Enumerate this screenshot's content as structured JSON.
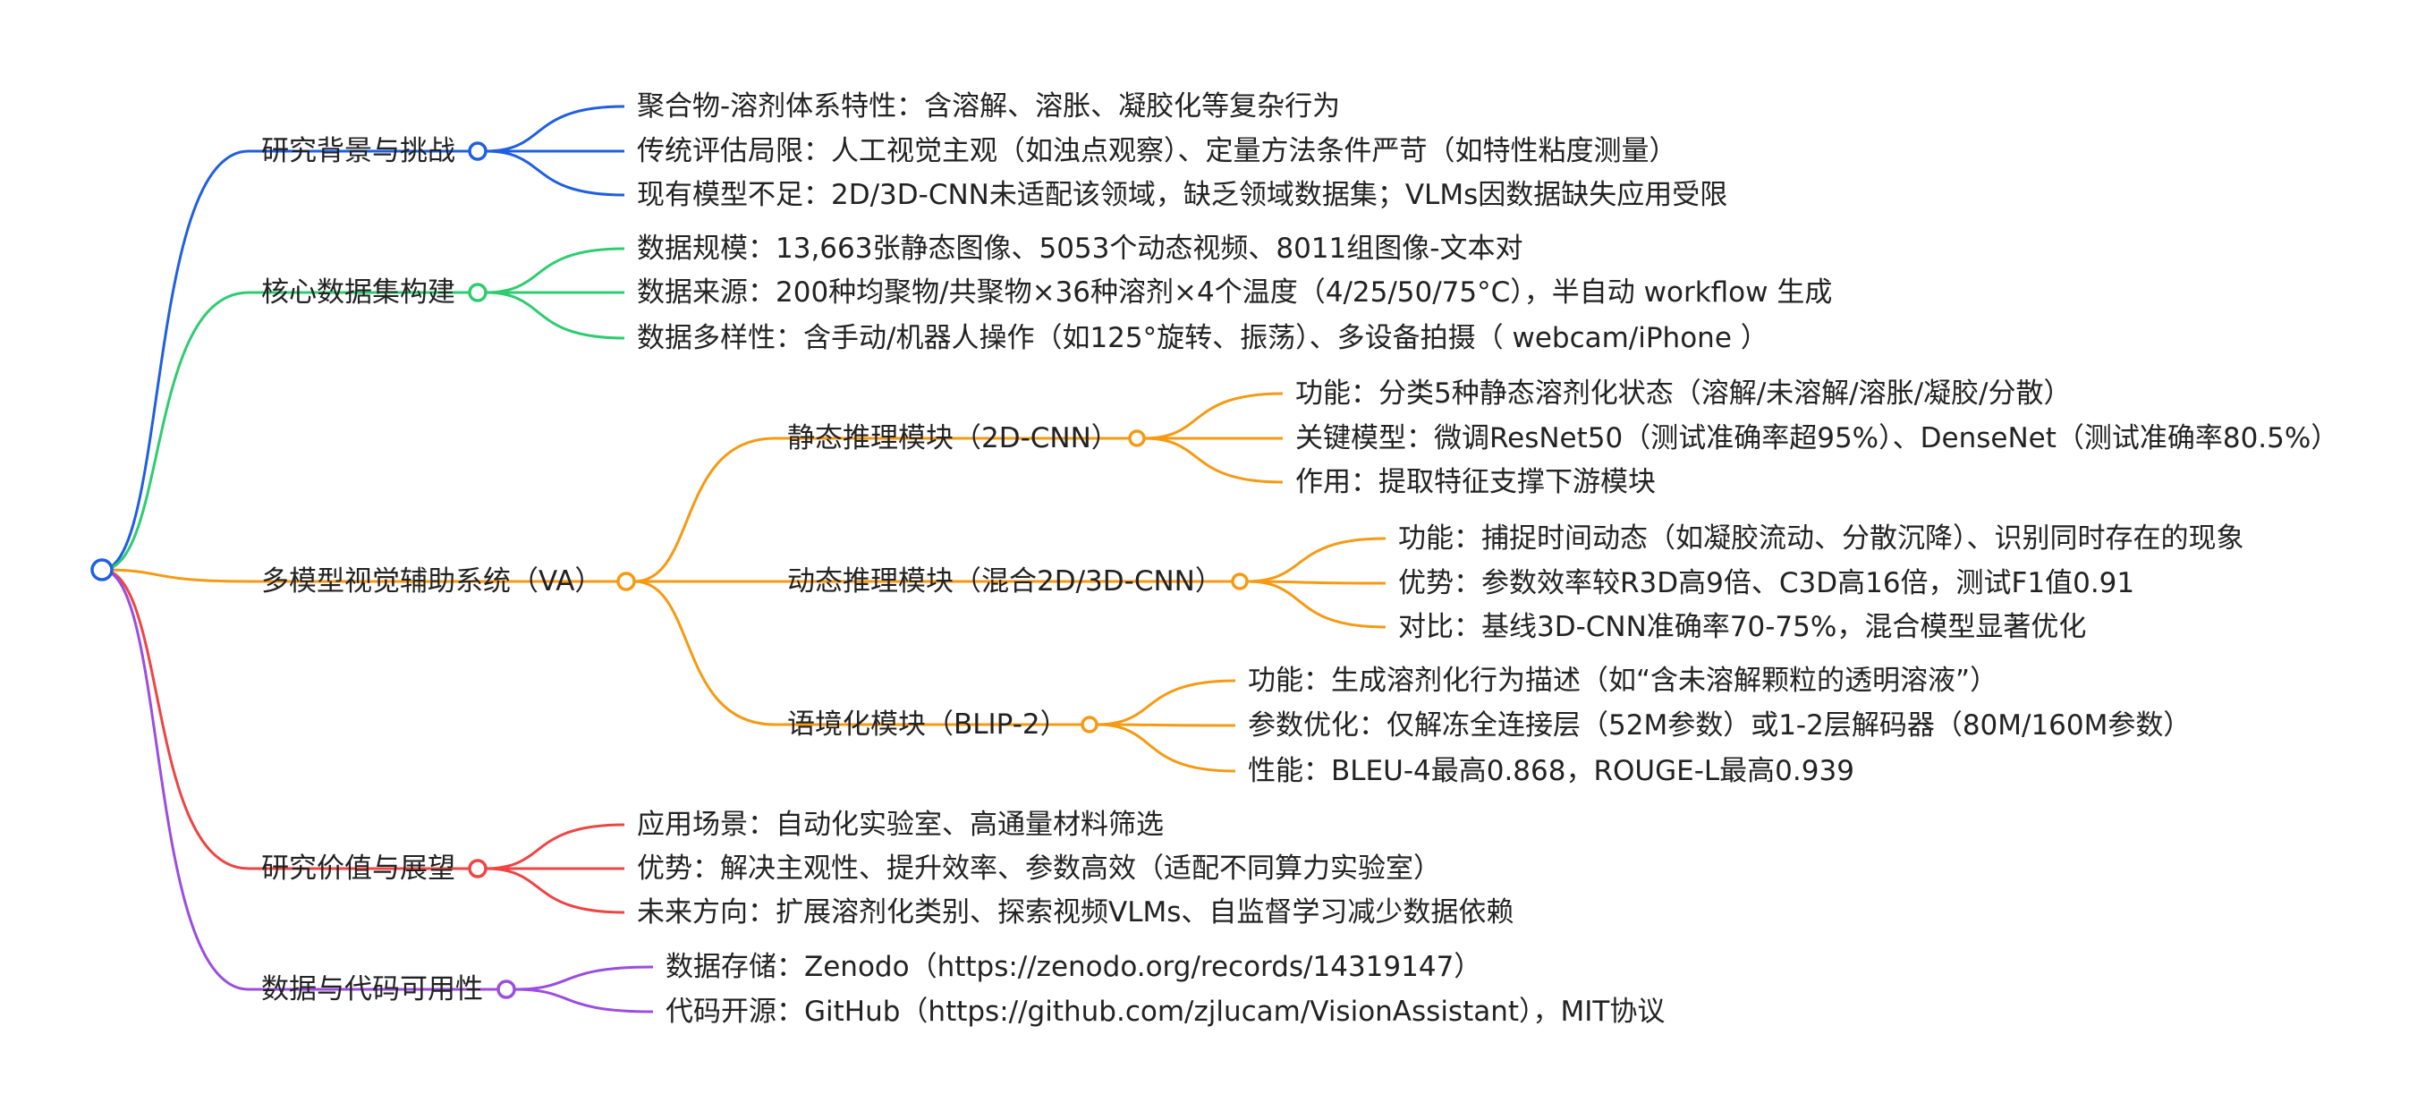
{
  "colors": {
    "blue": "#1f5fe0",
    "green": "#2ecc71",
    "orange": "#f59a12",
    "red": "#ef4444",
    "purple": "#9b4de0",
    "text": "#222222"
  },
  "mindmap": {
    "branches": [
      {
        "color": "blue",
        "label": "研究背景与挑战",
        "children": [
          {
            "label": "聚合物-溶剂体系特性：含溶解、溶胀、凝胶化等复杂行为"
          },
          {
            "label": "传统评估局限：人工视觉主观（如浊点观察）、定量方法条件严苛（如特性粘度测量）"
          },
          {
            "label": "现有模型不足：2D/3D-CNN未适配该领域，缺乏领域数据集；VLMs因数据缺失应用受限"
          }
        ]
      },
      {
        "color": "green",
        "label": "核心数据集构建",
        "children": [
          {
            "label": "数据规模：13,663张静态图像、5053个动态视频、8011组图像-文本对"
          },
          {
            "label": "数据来源：200种均聚物/共聚物×36种溶剂×4个温度（4/25/50/75°C），半自动 workflow 生成"
          },
          {
            "label": "数据多样性：含手动/机器人操作（如125°旋转、振荡）、多设备拍摄（ webcam/iPhone ）"
          }
        ]
      },
      {
        "color": "orange",
        "label": "多模型视觉辅助系统（VA）",
        "children": [
          {
            "label": "静态推理模块（2D-CNN）",
            "children": [
              {
                "label": "功能：分类5种静态溶剂化状态（溶解/未溶解/溶胀/凝胶/分散）"
              },
              {
                "label": "关键模型：微调ResNet50（测试准确率超95%）、DenseNet（测试准确率80.5%）"
              },
              {
                "label": "作用：提取特征支撑下游模块"
              }
            ]
          },
          {
            "label": "动态推理模块（混合2D/3D-CNN）",
            "children": [
              {
                "label": "功能：捕捉时间动态（如凝胶流动、分散沉降）、识别同时存在的现象"
              },
              {
                "label": "优势：参数效率较R3D高9倍、C3D高16倍，测试F1值0.91"
              },
              {
                "label": "对比：基线3D-CNN准确率70-75%，混合模型显著优化"
              }
            ]
          },
          {
            "label": "语境化模块（BLIP-2）",
            "children": [
              {
                "label": "功能：生成溶剂化行为描述（如“含未溶解颗粒的透明溶液”）"
              },
              {
                "label": "参数优化：仅解冻全连接层（52M参数）或1-2层解码器（80M/160M参数）"
              },
              {
                "label": "性能：BLEU-4最高0.868，ROUGE-L最高0.939"
              }
            ]
          }
        ]
      },
      {
        "color": "red",
        "label": "研究价值与展望",
        "children": [
          {
            "label": "应用场景：自动化实验室、高通量材料筛选"
          },
          {
            "label": "优势：解决主观性、提升效率、参数高效（适配不同算力实验室）"
          },
          {
            "label": "未来方向：扩展溶剂化类别、探索视频VLMs、自监督学习减少数据依赖"
          }
        ]
      },
      {
        "color": "purple",
        "label": "数据与代码可用性",
        "children": [
          {
            "label": "数据存储：Zenodo（https://zenodo.org/records/14319147）"
          },
          {
            "label": "代码开源：GitHub（https://github.com/zjlucam/VisionAssistant），MIT协议"
          }
        ]
      }
    ]
  }
}
